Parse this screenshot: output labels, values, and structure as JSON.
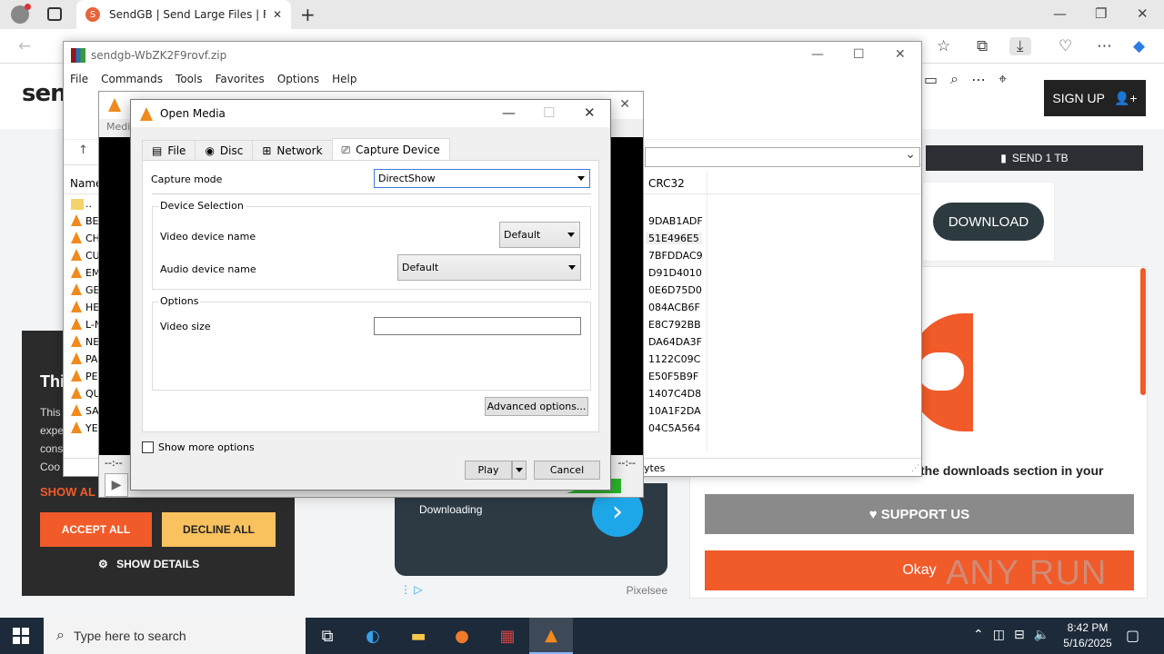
{
  "browser": {
    "tab_title": "SendGB | Send Large Files | Free f",
    "new_tab": "+",
    "minimize": "—",
    "restore": "❐",
    "close": "✕"
  },
  "site": {
    "logo": "sen",
    "signup": "SIGN UP",
    "send_button": "SEND 1 TB",
    "download_button": "DOWNLOAD",
    "downloads_text": "the downloads section in your",
    "support": "SUPPORT US",
    "okay": "Okay",
    "watermark": "ANY RUN",
    "ad_text": "Downloading",
    "ad_brand": "Pixelsee",
    "cookie": {
      "title": "Thi",
      "desc_lines": [
        "This",
        "expe",
        "cons",
        "Coo"
      ],
      "show_all": "SHOW AL",
      "accept": "ACCEPT ALL",
      "decline": "DECLINE ALL",
      "details": "SHOW DETAILS"
    }
  },
  "winrar": {
    "title": "sendgb-WbZK2F9rovf.zip",
    "menu": [
      "File",
      "Commands",
      "Tools",
      "Favorites",
      "Options",
      "Help"
    ],
    "col_name": "Name",
    "col_crc": "CRC32",
    "rows": [
      {
        "name": "..",
        "crc": ""
      },
      {
        "name": "BE",
        "crc": "9DAB1ADF"
      },
      {
        "name": "CH",
        "crc": "51E496E5"
      },
      {
        "name": "CU",
        "crc": "7BFDDAC9"
      },
      {
        "name": "EM",
        "crc": "D91D4010"
      },
      {
        "name": "GE",
        "crc": "0E6D75D0"
      },
      {
        "name": "HE",
        "crc": "084ACB6F"
      },
      {
        "name": "L-N",
        "crc": "E8C792BB"
      },
      {
        "name": "NE",
        "crc": "DA64DA3F"
      },
      {
        "name": "PA",
        "crc": "1122C09C"
      },
      {
        "name": "PE",
        "crc": "E50F5B9F"
      },
      {
        "name": "QU",
        "crc": "1407C4D8"
      },
      {
        "name": "SA",
        "crc": "10A1F2DA"
      },
      {
        "name": "YE",
        "crc": "04C5A564"
      }
    ],
    "status_bytes": "ytes"
  },
  "vlc": {
    "title": "Medi",
    "time_left": "--:--",
    "time_right": "--:--"
  },
  "open_media": {
    "title": "Open Media",
    "tabs": [
      "File",
      "Disc",
      "Network",
      "Capture Device"
    ],
    "capture_mode_label": "Capture mode",
    "capture_mode_value": "DirectShow",
    "device_selection": "Device Selection",
    "video_device_label": "Video device name",
    "video_device_value": "Default",
    "audio_device_label": "Audio device name",
    "audio_device_value": "Default",
    "options_label": "Options",
    "video_size_label": "Video size",
    "video_size_value": "",
    "advanced": "Advanced options...",
    "show_more": "Show more options",
    "play": "Play",
    "cancel": "Cancel"
  },
  "taskbar": {
    "search_placeholder": "Type here to search",
    "time": "8:42 PM",
    "date": "5/16/2025"
  }
}
